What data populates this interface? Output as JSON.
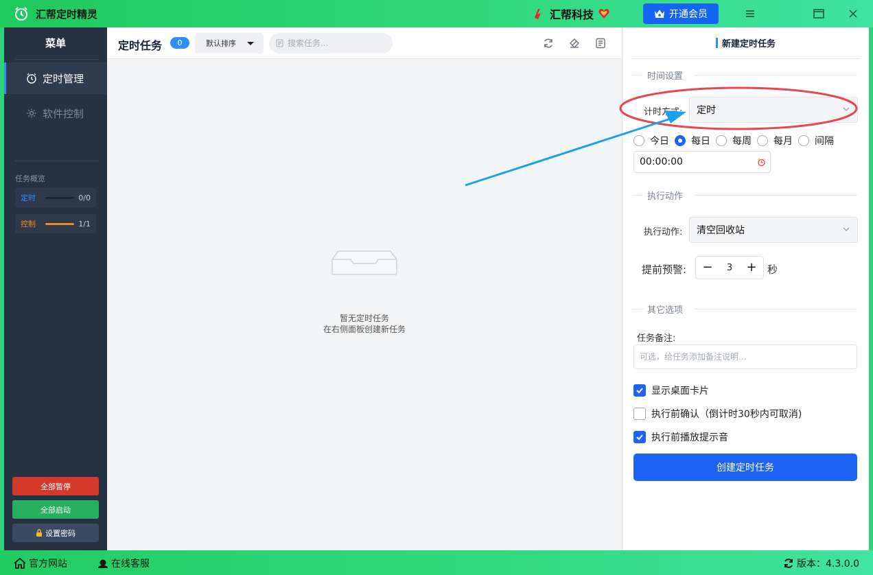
{
  "titlebar": {
    "app_title": "汇帮定时精灵",
    "brand": "汇帮科技",
    "vip_button": "开通会员",
    "icons": [
      "app-clock-icon",
      "brand-logo-icon",
      "heart-shield-icon",
      "menu-icon",
      "maximize-icon",
      "close-icon"
    ]
  },
  "sidebar": {
    "menu_title": "菜单",
    "items": [
      {
        "label": "定时管理",
        "icon": "alarm-clock-icon",
        "active": true
      },
      {
        "label": "软件控制",
        "icon": "gear-icon",
        "active": false
      }
    ],
    "overview_title": "任务概览",
    "stats": [
      {
        "label": "定时",
        "value": "0/0",
        "fill": 0,
        "color": "#2f8ff7"
      },
      {
        "label": "控制",
        "value": "1/1",
        "fill": 1,
        "color": "#f08a24"
      }
    ],
    "buttons": {
      "pause_all": "全部暂停",
      "start_all": "全部启动",
      "set_password": "设置密码"
    },
    "colors": {
      "pause": "#d33a2c",
      "start": "#27ae5f",
      "password": "#3a4a62"
    }
  },
  "main": {
    "title": "定时任务",
    "count": "0",
    "sort_label": "默认排序",
    "search_placeholder": "搜索任务...",
    "empty_line1": "暂无定时任务",
    "empty_line2": "在右侧面板创建新任务"
  },
  "panel": {
    "title": "新建定时任务",
    "section_time": "时间设置",
    "timing_label": "计时方式:",
    "timing_value": "定时",
    "radios": [
      {
        "label": "今日",
        "checked": false
      },
      {
        "label": "每日",
        "checked": true
      },
      {
        "label": "每周",
        "checked": false
      },
      {
        "label": "每月",
        "checked": false
      },
      {
        "label": "间隔",
        "checked": false
      }
    ],
    "time_value": "00:00:00",
    "section_action": "执行动作",
    "action_label": "执行动作:",
    "action_value": "清空回收站",
    "warn_label": "提前预警:",
    "warn_value": "3",
    "warn_unit": "秒",
    "section_other": "其它选项",
    "note_label": "任务备注:",
    "note_placeholder": "可选，给任务添加备注说明...",
    "checks": [
      {
        "label": "显示桌面卡片",
        "checked": true
      },
      {
        "label": "执行前确认（倒计时30秒内可取消)",
        "checked": false
      },
      {
        "label": "执行前播放提示音",
        "checked": true
      }
    ],
    "create_button": "创建定时任务"
  },
  "statusbar": {
    "website": "官方网站",
    "support": "在线客服",
    "version": "版本：4.3.0.0"
  },
  "accent": "#1d63f5"
}
